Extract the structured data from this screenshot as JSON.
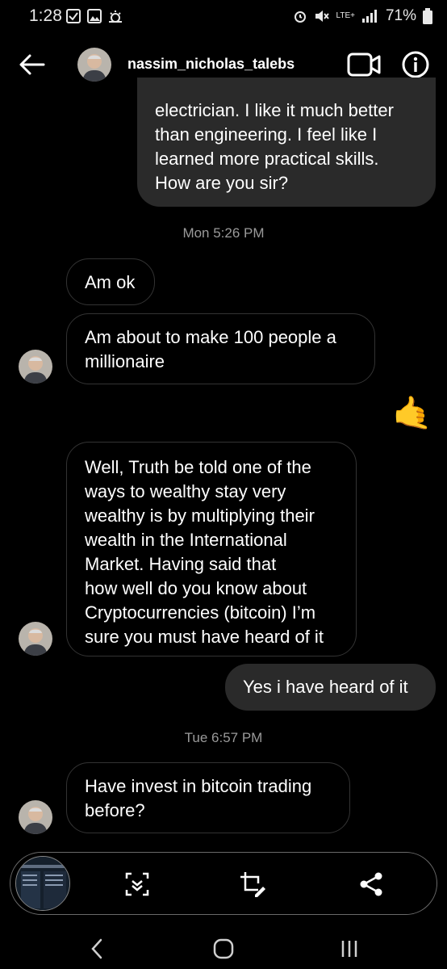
{
  "status": {
    "time": "1:28",
    "battery": "71%",
    "network": "LTE+"
  },
  "header": {
    "username": "nassim_nicholas_talebs"
  },
  "messages": {
    "m1": {
      "line1": "electrician. I like it much better",
      "line2": "than engineering. I feel like I",
      "line3": "learned more practical skills.",
      "line4": "How are you sir?"
    },
    "ts1": "Mon 5:26 PM",
    "m2": "Am ok",
    "m3": {
      "line1": "Am about to make 100 people a",
      "line2": "millionaire"
    },
    "reaction_emoji": "🤙",
    "m4": {
      "line1": "Well, Truth be told one of the",
      "line2": "ways to wealthy stay very",
      "line3": "wealthy is by multiplying their",
      "line4": "wealth in the International",
      "line5": "Market. Having said that",
      "line6": "how well do you know about",
      "line7": "Cryptocurrencies (bitcoin) I’m",
      "line8": "sure you must have heard of it"
    },
    "m5": "Yes i have heard of it",
    "ts2": "Tue 6:57 PM",
    "m6": {
      "line1": "Have invest in bitcoin trading",
      "line2": "before?"
    }
  },
  "toolbar": {
    "icons": [
      "screenshot-thumbnail",
      "scroll-capture-icon",
      "crop-edit-icon",
      "share-icon"
    ]
  },
  "navbar": {
    "icons": [
      "back-nav-icon",
      "home-nav-icon",
      "recents-nav-icon"
    ]
  }
}
